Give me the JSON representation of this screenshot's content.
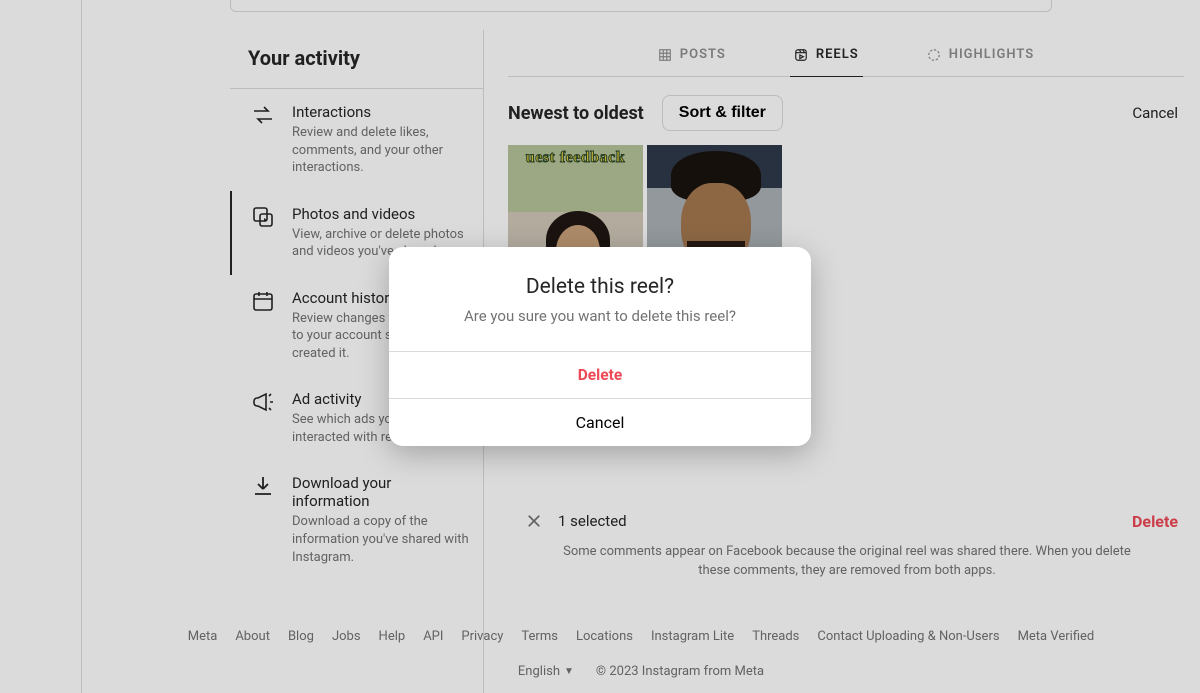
{
  "sidebar": {
    "heading": "Your activity",
    "items": [
      {
        "icon": "arrows",
        "title": "Interactions",
        "desc": "Review and delete likes, comments, and your other interactions."
      },
      {
        "icon": "media",
        "title": "Photos and videos",
        "desc": "View, archive or delete photos and videos you've shared."
      },
      {
        "icon": "calendar",
        "title": "Account history",
        "desc": "Review changes you've made to your account since you created it."
      },
      {
        "icon": "megaphone",
        "title": "Ad activity",
        "desc": "See which ads you've interacted with recently."
      },
      {
        "icon": "download",
        "title": "Download your information",
        "desc": "Download a copy of the information you've shared with Instagram."
      }
    ]
  },
  "tabs": {
    "posts": "POSTS",
    "reels": "REELS",
    "highlights": "HIGHLIGHTS",
    "active": "reels"
  },
  "toolbar": {
    "sort_label": "Newest to oldest",
    "filter_label": "Sort & filter",
    "cancel_label": "Cancel"
  },
  "thumbs": {
    "overlay_text_0": "uest feedback"
  },
  "selectbar": {
    "count_text": "1 selected",
    "delete_label": "Delete",
    "hint": "Some comments appear on Facebook because the original reel was shared there. When you delete these comments, they are removed from both apps."
  },
  "modal": {
    "title": "Delete this reel?",
    "message": "Are you sure you want to delete this reel?",
    "delete_label": "Delete",
    "cancel_label": "Cancel"
  },
  "footer": {
    "links": [
      "Meta",
      "About",
      "Blog",
      "Jobs",
      "Help",
      "API",
      "Privacy",
      "Terms",
      "Locations",
      "Instagram Lite",
      "Threads",
      "Contact Uploading & Non-Users",
      "Meta Verified"
    ],
    "language": "English",
    "copyright": "© 2023 Instagram from Meta"
  }
}
